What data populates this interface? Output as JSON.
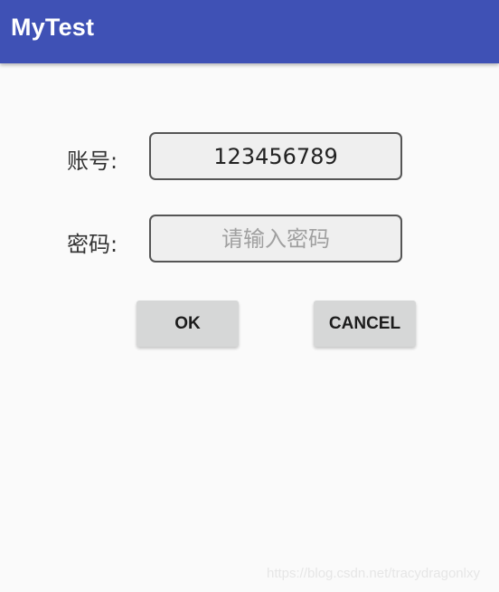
{
  "app": {
    "title": "MyTest"
  },
  "form": {
    "account_label": "账号:",
    "account_value": "123456789",
    "password_label": "密码:",
    "password_placeholder": "请输入密码",
    "password_value": ""
  },
  "buttons": {
    "ok": "OK",
    "cancel": "CANCEL"
  },
  "watermark": "https://blog.csdn.net/tracydragonlxy",
  "colors": {
    "appbar": "#3f51b5",
    "background": "#fafafa",
    "button": "#d6d7d7",
    "field": "#efefef"
  }
}
